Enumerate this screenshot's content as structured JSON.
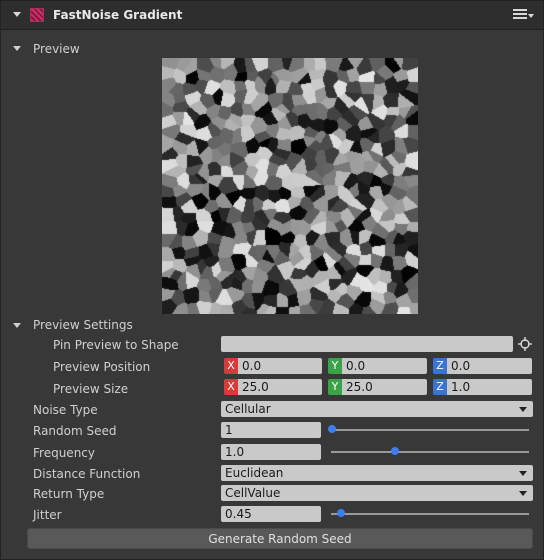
{
  "header": {
    "title": "FastNoise Gradient",
    "menu_icon": "hamburger-icon"
  },
  "preview": {
    "section_label": "Preview",
    "image": "cellular-noise-preview"
  },
  "preview_settings": {
    "section_label": "Preview Settings",
    "pin_label": "Pin Preview to Shape",
    "pin_value": "",
    "position_label": "Preview Position",
    "position": {
      "x": "0.0",
      "y": "0.0",
      "z": "0.0"
    },
    "size_label": "Preview Size",
    "size": {
      "x": "25.0",
      "y": "25.0",
      "z": "1.0"
    },
    "axis_labels": {
      "x": "X",
      "y": "Y",
      "z": "Z"
    }
  },
  "properties": {
    "noise_type_label": "Noise Type",
    "noise_type": "Cellular",
    "random_seed_label": "Random Seed",
    "random_seed": "1",
    "random_seed_slider": 0.0,
    "frequency_label": "Frequency",
    "frequency": "1.0",
    "frequency_slider": 0.32,
    "distance_function_label": "Distance Function",
    "distance_function": "Euclidean",
    "return_type_label": "Return Type",
    "return_type": "CellValue",
    "jitter_label": "Jitter",
    "jitter": "0.45",
    "jitter_slider": 0.045
  },
  "actions": {
    "generate_seed_label": "Generate Random Seed"
  },
  "colors": {
    "axis_x": "#d63a3a",
    "axis_y": "#3aa34a",
    "axis_z": "#3a73d6",
    "slider_thumb": "#3d7ff0",
    "accent": "#d0306a"
  }
}
